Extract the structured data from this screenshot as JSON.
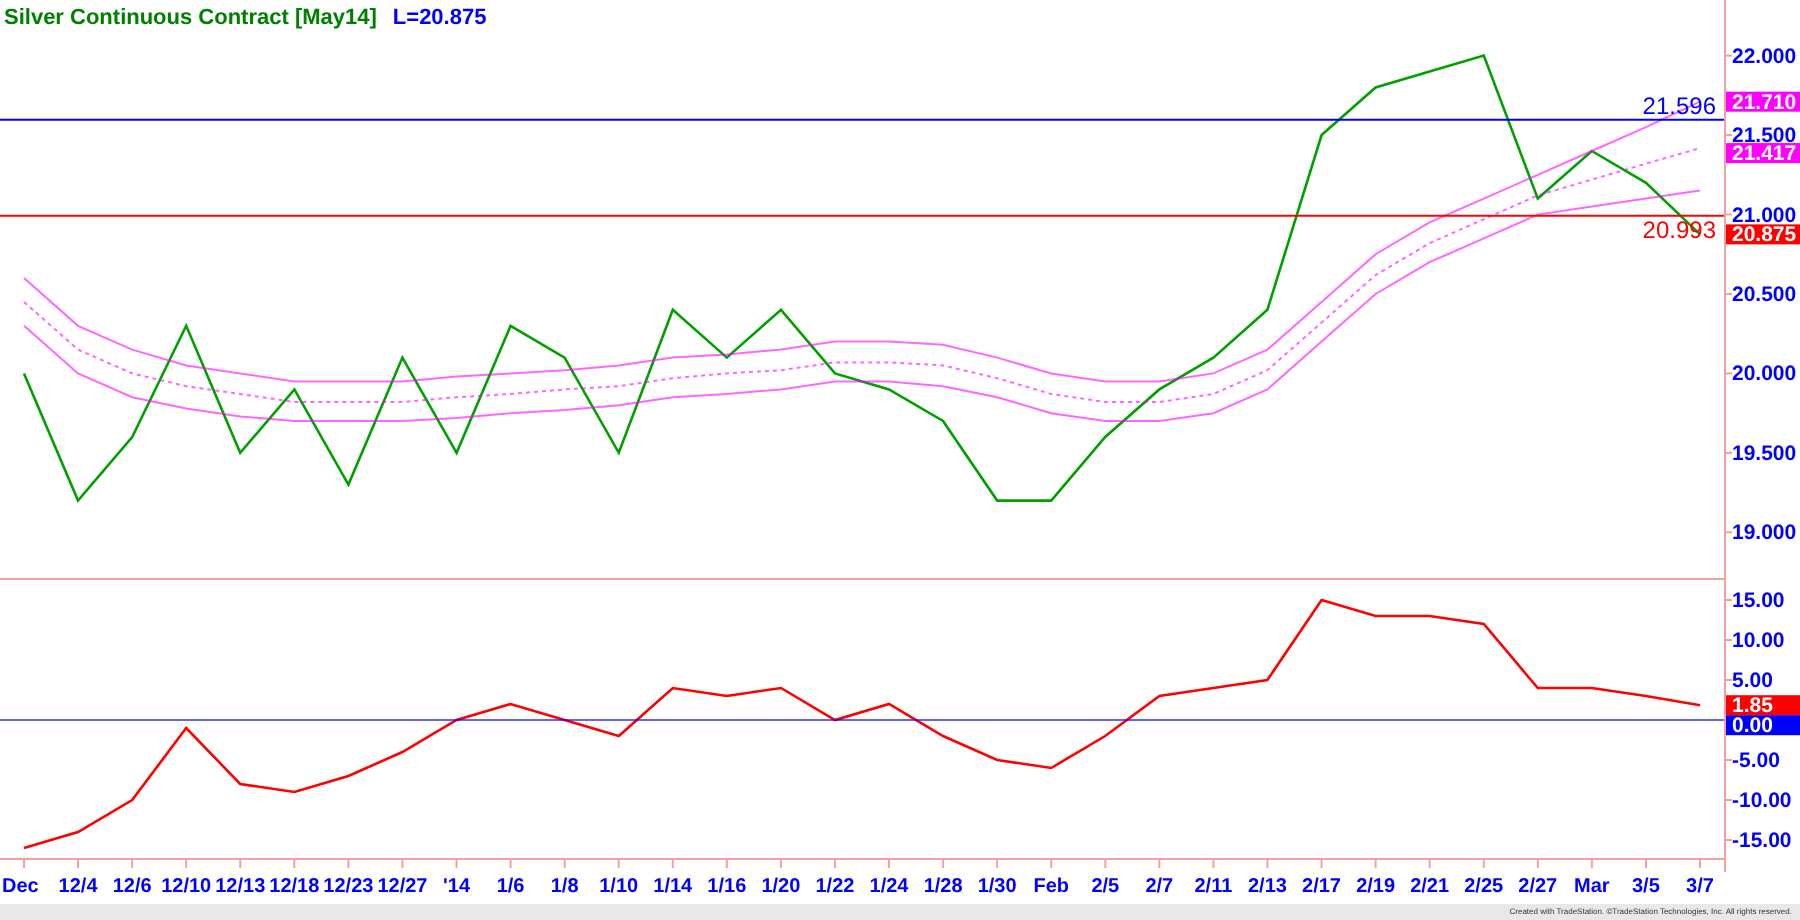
{
  "title": {
    "symbol": "Silver Continuous Contract [May14]",
    "last": "L=20.875"
  },
  "price_chart": {
    "chart_data": {
      "type": "line",
      "series": [
        {
          "color": "#00a000",
          "values": [
            20.0,
            19.2,
            19.6,
            20.3,
            19.5,
            19.9,
            19.3,
            20.1,
            19.5,
            20.3,
            20.1,
            19.5,
            20.4,
            20.1,
            20.4,
            20.0,
            19.9,
            19.7,
            19.2,
            19.2,
            19.6,
            19.9,
            20.1,
            20.4,
            21.5,
            21.8,
            21.9,
            22.0,
            21.1,
            21.4,
            21.2,
            20.875
          ]
        },
        {
          "color": "#ff00ff",
          "values": [
            20.6,
            20.3,
            20.15,
            20.05,
            20.0,
            19.95,
            19.95,
            19.95,
            19.98,
            20.0,
            20.02,
            20.05,
            20.1,
            20.12,
            20.15,
            20.2,
            20.2,
            20.18,
            20.1,
            20.0,
            19.95,
            19.95,
            20.0,
            20.15,
            20.45,
            20.75,
            20.95,
            21.1,
            21.25,
            21.4,
            21.55,
            21.71
          ]
        },
        {
          "color": "#ff00ff",
          "line_style": "dashed",
          "values": [
            20.45,
            20.15,
            20.0,
            19.92,
            19.87,
            19.82,
            19.82,
            19.82,
            19.85,
            19.87,
            19.9,
            19.92,
            19.97,
            20.0,
            20.02,
            20.07,
            20.07,
            20.05,
            19.97,
            19.87,
            19.82,
            19.82,
            19.87,
            20.02,
            20.32,
            20.62,
            20.82,
            20.97,
            21.12,
            21.22,
            21.32,
            21.417
          ]
        },
        {
          "color": "#ff00ff",
          "values": [
            20.3,
            20.0,
            19.85,
            19.78,
            19.73,
            19.7,
            19.7,
            19.7,
            19.72,
            19.75,
            19.77,
            19.8,
            19.85,
            19.87,
            19.9,
            19.95,
            19.95,
            19.92,
            19.85,
            19.75,
            19.7,
            19.7,
            19.75,
            19.9,
            20.2,
            20.5,
            20.7,
            20.85,
            21.0,
            21.05,
            21.1,
            21.15
          ]
        }
      ],
      "ylim": [
        18.7,
        22.35
      ],
      "yticks": [
        {
          "value": 19,
          "label": "19.000"
        },
        {
          "value": 19.5,
          "label": "19.500"
        },
        {
          "value": 20,
          "label": "20.000"
        },
        {
          "value": 20.5,
          "label": "20.500"
        },
        {
          "value": 21,
          "label": "21.000"
        },
        {
          "value": 21.5,
          "label": "21.500"
        },
        {
          "value": 22,
          "label": "22.000"
        }
      ],
      "ref_lines": [
        {
          "axis": "y",
          "value": 21.596,
          "label": "21.596",
          "color": "#0000ff"
        },
        {
          "axis": "y",
          "value": 20.993,
          "label": "20.993",
          "color": "#ff0000"
        }
      ],
      "annotations": [
        "21.710",
        "21.417",
        "20.875"
      ]
    }
  },
  "indicator_chart": {
    "chart_data": {
      "type": "line",
      "categories": [
        "Dec",
        "12/4",
        "12/6",
        "12/10",
        "12/13",
        "12/18",
        "12/23",
        "12/27",
        "'14",
        "1/6",
        "1/8",
        "1/10",
        "1/14",
        "1/16",
        "1/20",
        "1/22",
        "1/24",
        "1/28",
        "1/30",
        "Feb",
        "2/5",
        "2/7",
        "2/11",
        "2/13",
        "2/17",
        "2/19",
        "2/21",
        "2/25",
        "2/27",
        "Mar",
        "3/5",
        "3/7"
      ],
      "series": [
        {
          "color": "#ff0000",
          "values": [
            -16,
            -14,
            -10,
            -1,
            -8,
            -9,
            -7,
            -4,
            0,
            2,
            0,
            -2,
            4,
            3,
            4,
            0,
            2,
            -2,
            -5,
            -6,
            -2,
            3,
            4,
            5,
            15,
            13,
            13,
            12,
            4,
            4,
            3,
            1.85
          ]
        }
      ],
      "ylim": [
        -17.5,
        17.5
      ],
      "yticks": [
        {
          "value": -15,
          "label": "-15.00"
        },
        {
          "value": -10,
          "label": "-10.00"
        },
        {
          "value": -5,
          "label": "-5.00"
        },
        {
          "value": 5,
          "label": "5.00"
        },
        {
          "value": 10,
          "label": "10.00"
        },
        {
          "value": 15,
          "label": "15.00"
        }
      ],
      "ref_lines": [
        {
          "axis": "y",
          "value": 0,
          "color": "#0000ff"
        }
      ],
      "annotations": [
        "1.85",
        "0.00"
      ]
    }
  },
  "footer": "Created with TradeStation. ©TradeStation Technologies, Inc. All rights reserved."
}
